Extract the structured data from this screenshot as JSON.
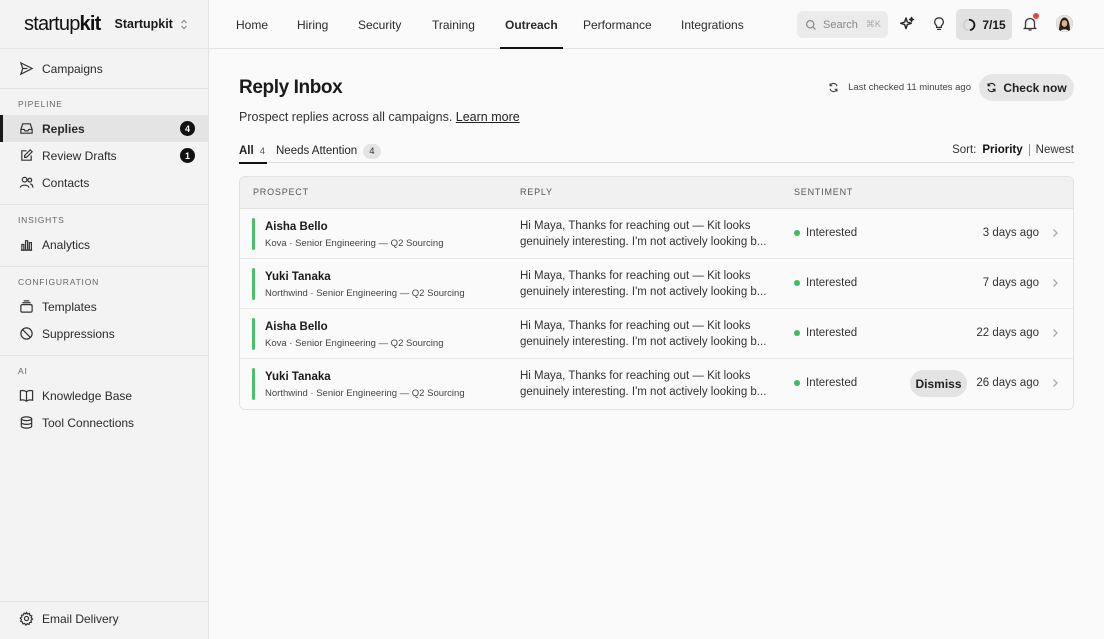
{
  "brand": {
    "logo_light": "startup",
    "logo_bold": "kit",
    "workspace": "Startupkit"
  },
  "sidebar": {
    "top_item": {
      "label": "Campaigns",
      "icon": "send-icon"
    },
    "sections": [
      {
        "label": "PIPELINE",
        "items": [
          {
            "label": "Replies",
            "icon": "inbox-icon",
            "badge": "4",
            "active": true
          },
          {
            "label": "Review Drafts",
            "icon": "edit-icon",
            "badge": "1"
          },
          {
            "label": "Contacts",
            "icon": "users-icon"
          }
        ]
      },
      {
        "label": "INSIGHTS",
        "items": [
          {
            "label": "Analytics",
            "icon": "bar-chart-icon"
          }
        ]
      },
      {
        "label": "CONFIGURATION",
        "items": [
          {
            "label": "Templates",
            "icon": "layers-icon"
          },
          {
            "label": "Suppressions",
            "icon": "ban-icon"
          }
        ]
      },
      {
        "label": "AI",
        "items": [
          {
            "label": "Knowledge Base",
            "icon": "book-icon"
          },
          {
            "label": "Tool Connections",
            "icon": "database-icon"
          }
        ]
      }
    ],
    "footer_item": {
      "label": "Email Delivery",
      "icon": "gear-icon"
    }
  },
  "topnav": {
    "tabs": [
      "Home",
      "Hiring",
      "Security",
      "Training",
      "Outreach",
      "Performance",
      "Integrations"
    ],
    "active_tab": "Outreach",
    "search_placeholder": "Search",
    "search_shortcut": "⌘K",
    "progress": "7/15",
    "notification_unread": true
  },
  "main": {
    "title": "Reply Inbox",
    "subtitle": "Prospect replies across all campaigns.",
    "learn_more": "Learn more",
    "last_checked": "Last checked 11 minutes ago",
    "check_now": "Check now",
    "filters": [
      {
        "label": "All",
        "count": "4",
        "active": true
      },
      {
        "label": "Needs Attention",
        "count": "4",
        "active": false
      }
    ],
    "sort_label": "Sort:",
    "sort_options": [
      "Priority",
      "Newest"
    ],
    "sort_selected": "Priority",
    "columns": [
      "PROSPECT",
      "REPLY",
      "SENTIMENT"
    ],
    "dismiss_label": "Dismiss",
    "rows": [
      {
        "name": "Aisha Bello",
        "meta": "Kova · Senior Engineering — Q2 Sourcing",
        "reply_line1": "Hi Maya, Thanks for reaching out — Kit looks",
        "reply_line2": "genuinely interesting. I'm not actively looking b...",
        "sentiment": "Interested",
        "time": "3 days ago"
      },
      {
        "name": "Yuki Tanaka",
        "meta": "Northwind · Senior Engineering — Q2 Sourcing",
        "reply_line1": "Hi Maya, Thanks for reaching out — Kit looks",
        "reply_line2": "genuinely interesting. I'm not actively looking b...",
        "sentiment": "Interested",
        "time": "7 days ago"
      },
      {
        "name": "Aisha Bello",
        "meta": "Kova · Senior Engineering — Q2 Sourcing",
        "reply_line1": "Hi Maya, Thanks for reaching out — Kit looks",
        "reply_line2": "genuinely interesting. I'm not actively looking b...",
        "sentiment": "Interested",
        "time": "22 days ago"
      },
      {
        "name": "Yuki Tanaka",
        "meta": "Northwind · Senior Engineering — Q2 Sourcing",
        "reply_line1": "Hi Maya, Thanks for reaching out — Kit looks",
        "reply_line2": "genuinely interesting. I'm not actively looking b...",
        "sentiment": "Interested",
        "time": "26 days ago",
        "show_dismiss": true
      }
    ]
  },
  "colors": {
    "accent_green": "#4cbf6a",
    "notification_red": "#e0483e",
    "active_bg": "#e4e4e4"
  }
}
